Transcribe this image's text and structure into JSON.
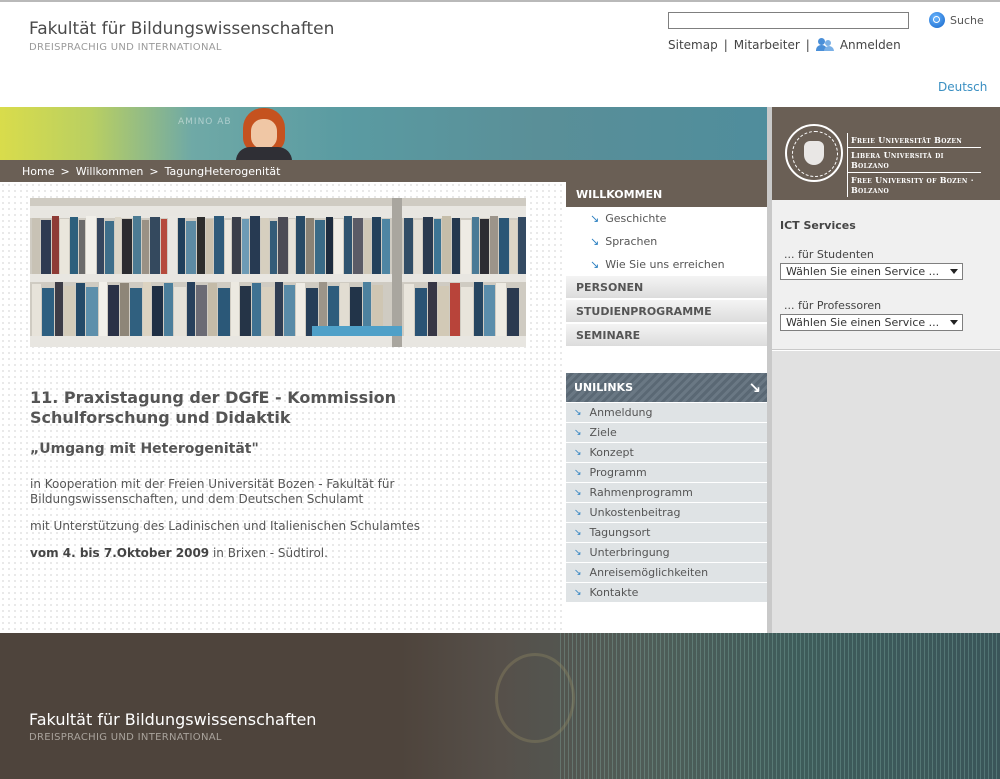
{
  "header": {
    "title": "Fakultät für Bildungswissenschaften",
    "subtitle": "DREISPRACHIG UND INTERNATIONAL",
    "search": {
      "value": "",
      "button_label": "Suche"
    },
    "links": {
      "sitemap": "Sitemap",
      "staff": "Mitarbeiter",
      "login": "Anmelden",
      "separator": "|"
    },
    "language": "Deutsch"
  },
  "breadcrumb": {
    "items": [
      "Home",
      "Willkommen",
      "TagungHeterogenität"
    ],
    "separator": ">"
  },
  "banner": {
    "board_text": "AMINO AB"
  },
  "content": {
    "title": "11. Praxistagung der DGfE - Kommission Schulforschung und Didaktik",
    "subtitle": "„Umgang mit Heterogenität\"",
    "paragraph1": "in Kooperation mit der Freien Universität Bozen - Fakultät für Bildungswissenschaften, und dem Deutschen Schulamt",
    "paragraph2": "mit Unterstützung des Ladinischen und Italienischen Schulamtes",
    "date_bold": "vom 4. bis 7.Oktober 2009",
    "date_rest": " in Brixen - Südtirol."
  },
  "nav": {
    "head": "WILLKOMMEN",
    "sub_items": [
      "Geschichte",
      "Sprachen",
      "Wie Sie uns erreichen"
    ],
    "sections": [
      "PERSONEN",
      "STUDIENPROGRAMME",
      "SEMINARE"
    ],
    "unilinks": {
      "title": "UNILINKS",
      "items": [
        "Anmeldung",
        "Ziele",
        "Konzept",
        "Programm",
        "Rahmenprogramm",
        "Unkostenbeitrag",
        "Tagungsort",
        "Unterbringung",
        "Anreisemöglichkeiten",
        "Kontakte"
      ]
    }
  },
  "university": {
    "names": [
      "Freie Universität Bozen",
      "Libera Università di Bolzano",
      "Free University of Bozen · Bolzano"
    ]
  },
  "ict": {
    "title": "ICT Services",
    "students_label": "... für Studenten",
    "students_select": "Wählen Sie einen Service ...",
    "professors_label": "... für Professoren",
    "professors_select": "Wählen Sie einen Service ..."
  },
  "footer": {
    "title": "Fakultät für Bildungswissenschaften",
    "subtitle": "DREISPRACHIG UND INTERNATIONAL"
  },
  "colors": {
    "brown": "#6a5f55",
    "link_blue": "#3a8fc2",
    "arrow_blue": "#2a7fc0",
    "unilink_bg": "#dfe3e5"
  },
  "icons": [
    "search-icon",
    "people-icon",
    "arrow-icon",
    "unilinks-arrow-icon",
    "university-seal-icon",
    "dropdown-caret-icon"
  ]
}
